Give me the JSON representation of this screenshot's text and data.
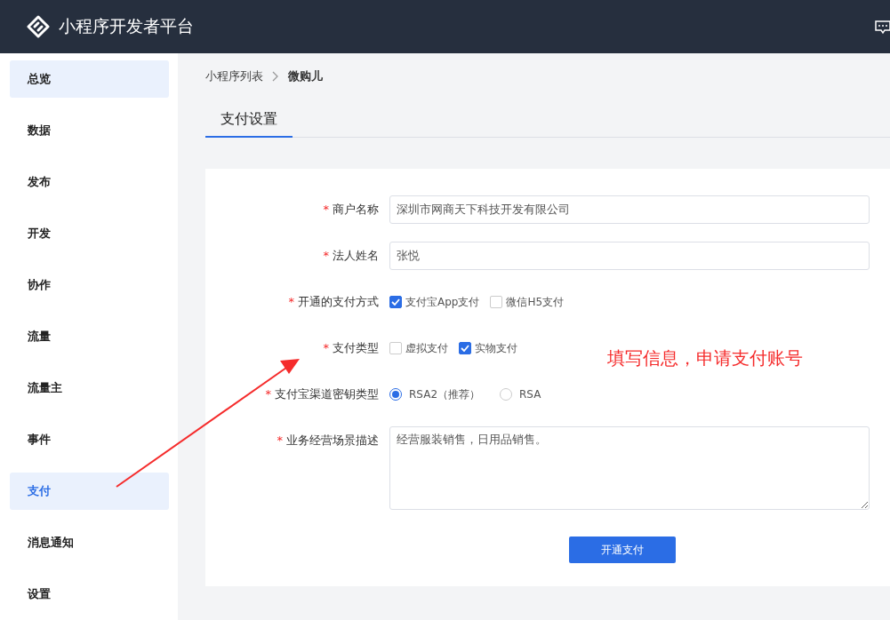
{
  "header": {
    "title": "小程序开发者平台"
  },
  "sidebar": {
    "items": [
      {
        "label": "总览",
        "highlighted": true,
        "selected": false
      },
      {
        "label": "数据",
        "highlighted": false,
        "selected": false
      },
      {
        "label": "发布",
        "highlighted": false,
        "selected": false
      },
      {
        "label": "开发",
        "highlighted": false,
        "selected": false
      },
      {
        "label": "协作",
        "highlighted": false,
        "selected": false
      },
      {
        "label": "流量",
        "highlighted": false,
        "selected": false
      },
      {
        "label": "流量主",
        "highlighted": false,
        "selected": false
      },
      {
        "label": "事件",
        "highlighted": false,
        "selected": false
      },
      {
        "label": "支付",
        "highlighted": true,
        "selected": true
      },
      {
        "label": "消息通知",
        "highlighted": false,
        "selected": false
      },
      {
        "label": "设置",
        "highlighted": false,
        "selected": false
      }
    ]
  },
  "breadcrumb": [
    "小程序列表",
    "微购儿"
  ],
  "tabs": [
    {
      "label": "支付设置",
      "selected": true
    }
  ],
  "form": {
    "fields": [
      {
        "kind": "text",
        "label": "商户名称",
        "required_mark": "*",
        "value": "深圳市网商天下科技开发有限公司"
      },
      {
        "kind": "text",
        "label": "法人姓名",
        "required_mark": "*",
        "value": "张悦"
      },
      {
        "kind": "checkbox",
        "label": "开通的支付方式",
        "required_mark": "*",
        "options": [
          {
            "label": "支付宝App支付",
            "checked": true
          },
          {
            "label": "微信H5支付",
            "checked": false
          }
        ]
      },
      {
        "kind": "checkbox",
        "label": "支付类型",
        "required_mark": "*",
        "options": [
          {
            "label": "虚拟支付",
            "checked": false
          },
          {
            "label": "实物支付",
            "checked": true
          }
        ]
      },
      {
        "kind": "radio",
        "label": "支付宝渠道密钥类型",
        "required_mark": "*",
        "options": [
          {
            "label": "RSA2（推荐）",
            "selected": true
          },
          {
            "label": "RSA",
            "selected": false
          }
        ]
      },
      {
        "kind": "textarea",
        "label": "业务经营场景描述",
        "required_mark": "*",
        "value": "经营服装销售，日用品销售。"
      }
    ],
    "submit": "开通支付"
  },
  "annotation": {
    "text": "填写信息，申请支付账号"
  }
}
